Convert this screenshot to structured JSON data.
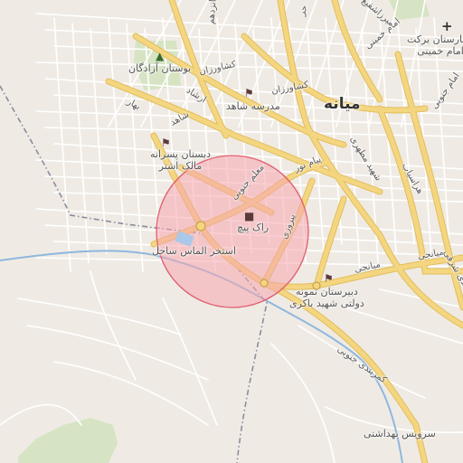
{
  "map": {
    "city_label": "میانه",
    "colors": {
      "land": "#efebe4",
      "street": "#ffffff",
      "main_road": "#f4d681",
      "main_road_outline": "#e2bd5a",
      "river": "#8fb7de",
      "park": "#d6e4c3",
      "circle_fill": "#f6a6ae",
      "circle_stroke": "#e06070",
      "boundary": "#8b8ba0"
    },
    "road_labels": [
      "کشاورزان",
      "کشاورزان",
      "ارشاد",
      "شاهد",
      "بهار",
      "معلم جنوبی",
      "پیام نور",
      "شهید مطهری",
      "پیروزی",
      "امام خمینی",
      "امام جنوبی",
      "حر",
      "میرزاشفیع",
      "هراسیاب",
      "میانجی",
      "میانجی",
      "کمربندی جنوبی",
      "کمربندی شرقی",
      "پانزدهم"
    ],
    "places": [
      {
        "label": "بوستان آزادگان",
        "icon": "tree-icon"
      },
      {
        "label": "مدرسه شاهد",
        "icon": "school-icon"
      },
      {
        "label": "دبستان پسرانه\nمالک اشتر",
        "icon": "school-icon"
      },
      {
        "label": "راک پیچ",
        "icon": "shop-icon"
      },
      {
        "label": "استخر الماس ساحل",
        "icon": "pool-icon"
      },
      {
        "label": "دبیرستان نمونه\nدولتی شهید باکری",
        "icon": "school-icon"
      },
      {
        "label": "بیمارستان برکت\nامام خمینی",
        "icon": "hospital-icon"
      },
      {
        "label": "سرویس بهداشتی",
        "icon": ""
      }
    ],
    "search_radius_circle": true
  }
}
